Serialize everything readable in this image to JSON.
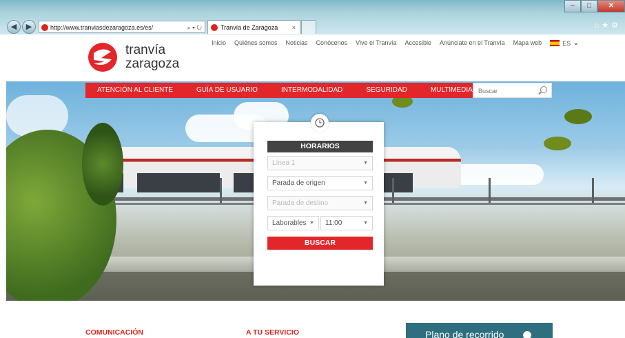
{
  "browser": {
    "url": "http://www.tranviasdezaragoza.es/es/",
    "tab_title": "Tranvía de Zaragoza"
  },
  "logo": {
    "line1": "tranvía",
    "line2": "zaragoza"
  },
  "topnav": {
    "items": [
      "Inicio",
      "Quiénes somos",
      "Noticias",
      "Conócenos",
      "Vive el Tranvía",
      "Accesible",
      "Anúnciate en el Tranvía",
      "Mapa web"
    ],
    "lang": "ES"
  },
  "mainnav": {
    "items": [
      "ATENCIÓN AL CLIENTE",
      "GUÍA DE USUARIO",
      "INTERMODALIDAD",
      "SEGURIDAD",
      "MULTIMEDIA"
    ],
    "search_placeholder": "Buscar"
  },
  "horarios": {
    "title": "HORARIOS",
    "linea": "Línea 1",
    "origen": "Parada de origen",
    "destino": "Parada de destino",
    "dia": "Laborables",
    "hora": "11:00",
    "button": "BUSCAR"
  },
  "footer": {
    "col1": "COMUNICACIÓN",
    "col2": "A TU SERVICIO",
    "plano": "Plano de recorrido"
  },
  "colors": {
    "brand_red": "#e3262a",
    "dark": "#434343",
    "teal": "#2e6f7f"
  }
}
